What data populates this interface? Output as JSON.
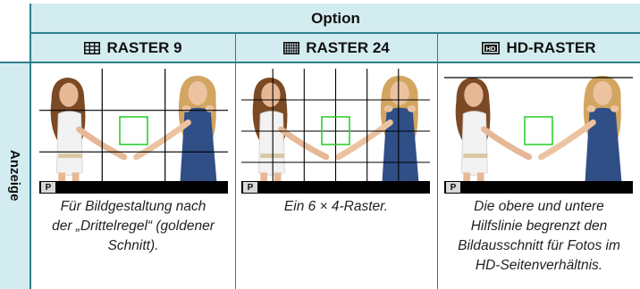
{
  "header": {
    "option_label": "Option",
    "row_label": "Anzeige"
  },
  "columns": [
    {
      "icon": "grid-3x3-icon",
      "title": "RASTER 9",
      "caption": "Für Bildgestaltung nach\nder „Drittelregel“ (goldener\nSchnitt)."
    },
    {
      "icon": "grid-6x4-icon",
      "title": "RASTER 24",
      "caption": "Ein 6 × 4-Raster."
    },
    {
      "icon": "hd-icon",
      "title": "HD-RASTER",
      "caption": "Die obere und untere\nHilfslinie begrenzt den\nBildausschnitt für Fotos im\nHD-Seitenverhältnis."
    }
  ],
  "preview": {
    "mode_badge": "P",
    "focus_frame_color": "#22cc22"
  },
  "colors": {
    "header_bg": "#d3ecf0",
    "rule": "#2f7f8c"
  }
}
